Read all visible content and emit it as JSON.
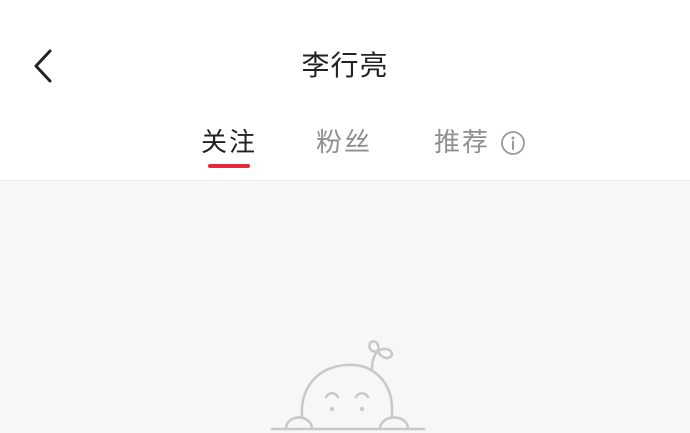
{
  "header": {
    "title": "李行亮",
    "back_icon": "chevron-left-icon"
  },
  "tabs": [
    {
      "label": "关注",
      "active": true
    },
    {
      "label": "粉丝",
      "active": false
    },
    {
      "label": "推荐",
      "active": false,
      "icon": "info-icon"
    }
  ],
  "colors": {
    "accent": "#e6273e",
    "title_text": "#222222",
    "inactive_tab": "#8f8f8f",
    "content_bg": "#f7f7f7",
    "illustration_stroke": "#c9c9c9"
  },
  "empty_state": {
    "illustration": "peeking-baby-illustration"
  }
}
